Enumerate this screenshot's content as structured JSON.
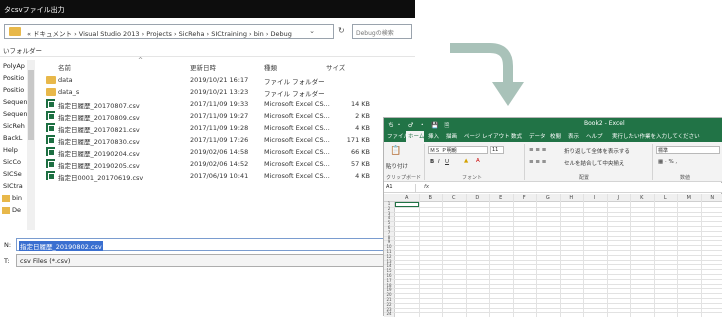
{
  "dialog": {
    "title": "タcsvファイル出力",
    "address": "« ドキュメント › Visual Studio 2013 › Projects › SicReha › SICtraining › bin › Debug",
    "search_placeholder": "Debugの検索",
    "new_folder": "いフォルダー",
    "nav_items": [
      "PolyAp ^",
      "Positio",
      "Positio",
      "Sequen",
      "Sequen",
      "SicReh",
      "BackL",
      "Help",
      "SicCo",
      "SICSe",
      "SICtra",
      "bin",
      "De"
    ],
    "columns": {
      "name": "名前",
      "date": "更新日時",
      "type": "種類",
      "size": "サイズ"
    },
    "files": [
      {
        "name": "data",
        "date": "2019/10/21 16:17",
        "type": "ファイル フォルダー",
        "size": "",
        "kind": "folder"
      },
      {
        "name": "data_s",
        "date": "2019/10/21 13:23",
        "type": "ファイル フォルダー",
        "size": "",
        "kind": "folder"
      },
      {
        "name": "指定日履歴_20170807.csv",
        "date": "2017/11/09 19:33",
        "type": "Microsoft Excel CS...",
        "size": "14 KB",
        "kind": "xl"
      },
      {
        "name": "指定日履歴_20170809.csv",
        "date": "2017/11/09 19:27",
        "type": "Microsoft Excel CS...",
        "size": "2 KB",
        "kind": "xl"
      },
      {
        "name": "指定日履歴_20170821.csv",
        "date": "2017/11/09 19:28",
        "type": "Microsoft Excel CS...",
        "size": "4 KB",
        "kind": "xl"
      },
      {
        "name": "指定日履歴_20170830.csv",
        "date": "2017/11/09 17:26",
        "type": "Microsoft Excel CS...",
        "size": "171 KB",
        "kind": "xl"
      },
      {
        "name": "指定日履歴_20190204.csv",
        "date": "2019/02/06 14:58",
        "type": "Microsoft Excel CS...",
        "size": "66 KB",
        "kind": "xl"
      },
      {
        "name": "指定日履歴_20190205.csv",
        "date": "2019/02/06 14:52",
        "type": "Microsoft Excel CS...",
        "size": "57 KB",
        "kind": "xl"
      },
      {
        "name": "指定日0001_20170619.csv",
        "date": "2017/06/19 10:41",
        "type": "Microsoft Excel CS...",
        "size": "4 KB",
        "kind": "xl"
      }
    ],
    "filename_label": "N:",
    "filename_value": "指定日履歴_20190802.csv",
    "filetype_label": "T:",
    "filetype_value": "csv Files (*.csv)"
  },
  "excel": {
    "qat": "ち・ ♂ ・ 💾 🗎",
    "book_title": "Book2 - Excel",
    "tabs": [
      "ファイル",
      "ホーム",
      "挿入",
      "描画",
      "ページ レイアウト",
      "数式",
      "データ",
      "校閲",
      "表示",
      "ヘルプ",
      "実行したい作業を入力してください"
    ],
    "ribbon": {
      "paste": "貼り付け",
      "clipboard": "クリップボード",
      "font_name": "ＭＳ Ｐ明朝",
      "font_size": "11",
      "font_group": "フォント",
      "wrap_text": "折り返して全体を表示する",
      "merge": "セルを結合して中央揃え",
      "align_group": "配置",
      "number_format": "標準",
      "number_group": "数値"
    },
    "namebox": "A1",
    "fx": "fx",
    "columns": [
      "A",
      "B",
      "C",
      "D",
      "E",
      "F",
      "G",
      "H",
      "I",
      "J",
      "K",
      "L",
      "M",
      "N"
    ],
    "rows": [
      "1",
      "2",
      "3",
      "4",
      "5",
      "6",
      "7",
      "8",
      "9",
      "10",
      "11",
      "12",
      "13",
      "14",
      "15",
      "16",
      "17",
      "18",
      "19",
      "20",
      "21",
      "22",
      "23",
      "24"
    ]
  },
  "colors": {
    "excel_green": "#217346",
    "arrow": "#a9c2b9",
    "folder": "#e8b84a",
    "selection": "#3a6fd0"
  }
}
